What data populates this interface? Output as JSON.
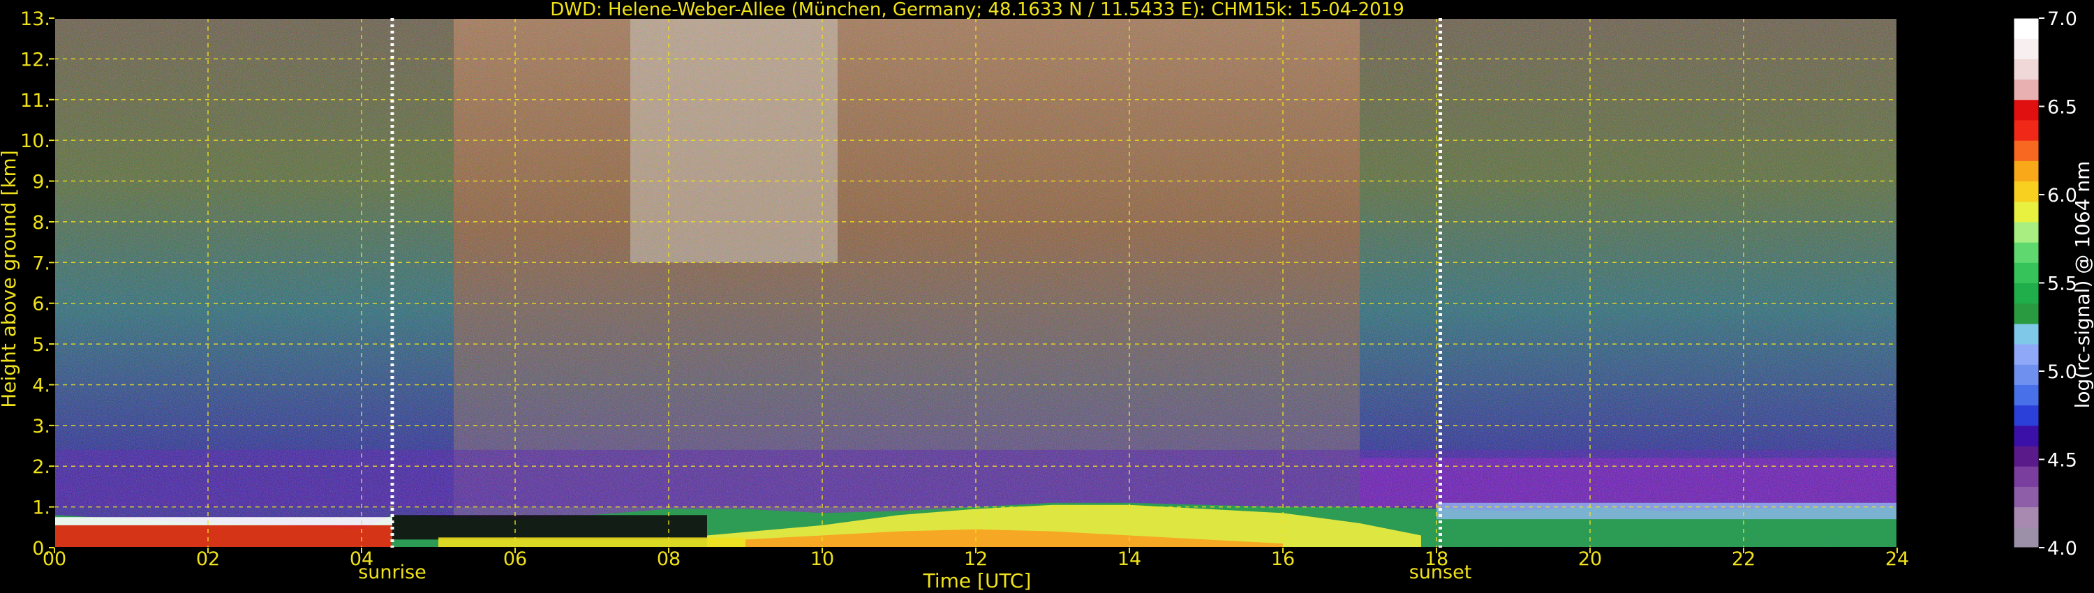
{
  "chart_data": {
    "type": "heatmap",
    "title": "DWD: Helene-Weber-Allee (München, Germany; 48.1633 N / 11.5433 E):    CHM15k: 15-04-2019",
    "xlabel": "Time [UTC]",
    "ylabel": "Height above ground [km]",
    "xlim": [
      0,
      24
    ],
    "ylim": [
      0,
      13
    ],
    "x_ticks": [
      0,
      2,
      4,
      6,
      8,
      10,
      12,
      14,
      16,
      18,
      20,
      22,
      24
    ],
    "x_tick_labels": [
      "00",
      "02",
      "04",
      "06",
      "08",
      "10",
      "12",
      "14",
      "16",
      "18",
      "20",
      "22",
      "24"
    ],
    "y_ticks": [
      0,
      1,
      2,
      3,
      4,
      5,
      6,
      7,
      8,
      9,
      10,
      11,
      12,
      13
    ],
    "y_tick_labels": [
      "0.",
      "1.",
      "2.",
      "3.",
      "4.",
      "5.",
      "6.",
      "7.",
      "8.",
      "9.",
      "10.",
      "11.",
      "12.",
      "13."
    ],
    "grid": true,
    "annotations": [
      {
        "text": "sunrise",
        "x": 4.4
      },
      {
        "text": "sunset",
        "x": 18.05
      }
    ],
    "colorbar": {
      "label": "log(rc-signal) @ 1064 nm",
      "range": [
        4.0,
        7.0
      ],
      "ticks": [
        4.0,
        4.5,
        5.0,
        5.5,
        6.0,
        6.5,
        7.0
      ],
      "tick_labels": [
        "4.0",
        "4.5",
        "5.0",
        "5.5",
        "6.0",
        "6.5",
        "7.0"
      ],
      "colors": [
        "#9c8fa8",
        "#a88ab0",
        "#8f5ea8",
        "#7a3e9e",
        "#5a1a8a",
        "#3a10a8",
        "#2a40d8",
        "#4870e8",
        "#7090f0",
        "#90a8f8",
        "#80c8e8",
        "#2a9a40",
        "#1fae4a",
        "#36c45a",
        "#5fd870",
        "#a8ee80",
        "#e8f040",
        "#f8d020",
        "#f8a818",
        "#f86820",
        "#f02818",
        "#e01010",
        "#e8b0b0",
        "#f0d8d8",
        "#f8f0f0",
        "#ffffff"
      ]
    },
    "series": [
      {
        "x": [
          0,
          1,
          2,
          3,
          4,
          4.4,
          5,
          6,
          7,
          8,
          9,
          10,
          11,
          12,
          13,
          14,
          15,
          16,
          17,
          18,
          19,
          20,
          21,
          22,
          23,
          24
        ],
        "boundary_layer_top_km": [
          0.8,
          0.7,
          0.6,
          0.55,
          0.45,
          0.8,
          0.75,
          0.7,
          0.8,
          0.95,
          0.95,
          0.85,
          0.9,
          1.0,
          1.1,
          1.1,
          1.05,
          1.0,
          1.0,
          0.95,
          0.9,
          1.0,
          0.9,
          0.95,
          1.0,
          1.0
        ]
      }
    ],
    "sun_lines_x": [
      4.4,
      18.05
    ]
  }
}
